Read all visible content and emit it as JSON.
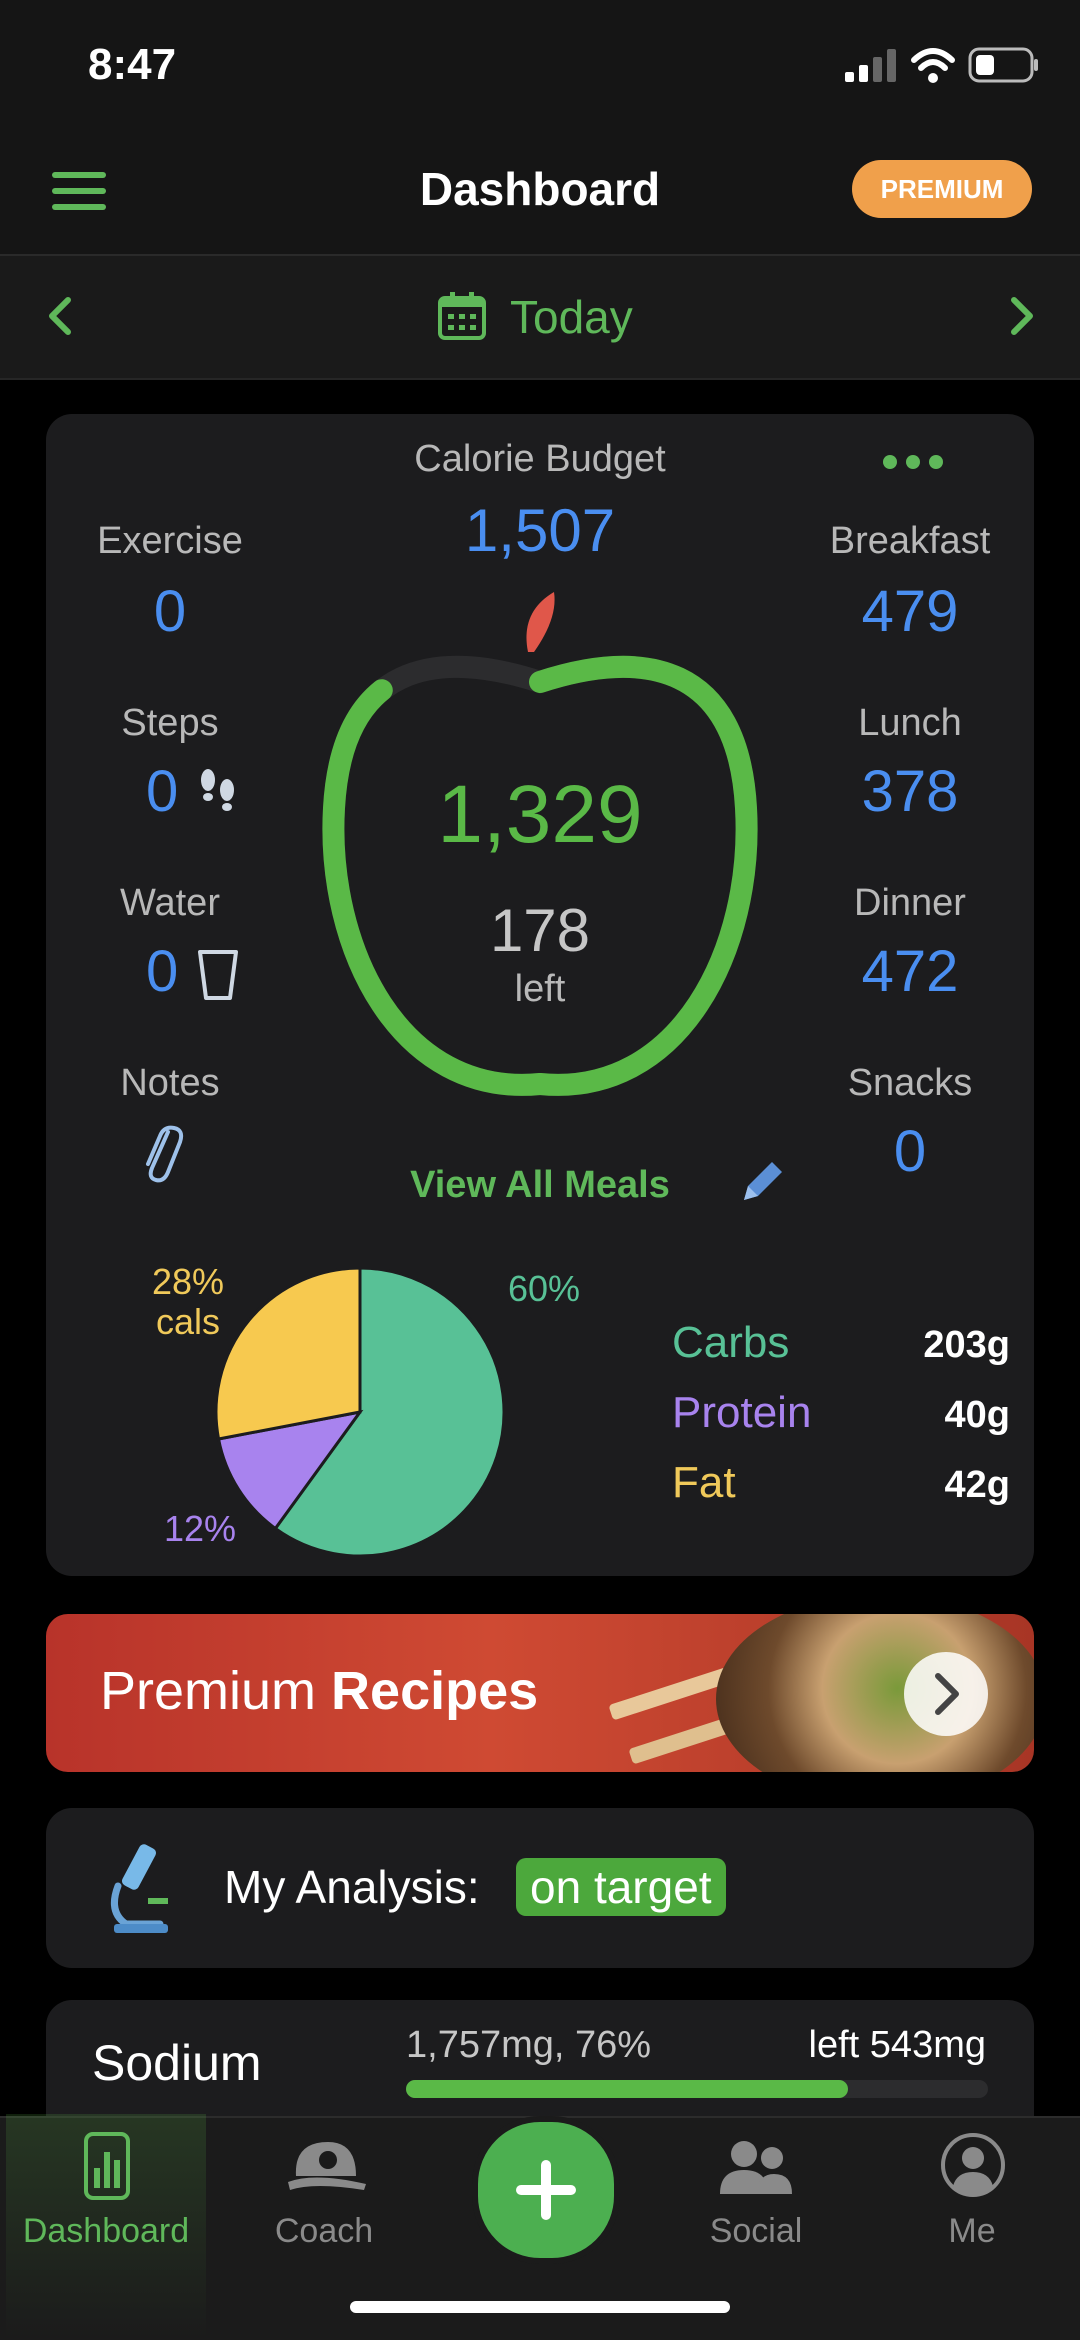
{
  "status": {
    "time": "8:47"
  },
  "header": {
    "title": "Dashboard",
    "premium_badge": "PREMIUM"
  },
  "date_nav": {
    "label": "Today"
  },
  "budget": {
    "title": "Calorie Budget",
    "value": "1,507",
    "eaten": "1,329",
    "left_value": "178",
    "left_label": "left",
    "progress_fraction": 0.88
  },
  "left_stats": [
    {
      "label": "Exercise",
      "value": "0"
    },
    {
      "label": "Steps",
      "value": "0"
    },
    {
      "label": "Water",
      "value": "0"
    },
    {
      "label": "Notes"
    }
  ],
  "meals": [
    {
      "label": "Breakfast",
      "value": "479"
    },
    {
      "label": "Lunch",
      "value": "378"
    },
    {
      "label": "Dinner",
      "value": "472"
    },
    {
      "label": "Snacks",
      "value": "0"
    }
  ],
  "view_all": "View All Meals",
  "pie": {
    "label_fat": "28%",
    "label_fat_sub": "cals",
    "label_carbs": "60%",
    "label_protein": "12%"
  },
  "chart_data": {
    "type": "pie",
    "labels": [
      "Carbs",
      "Protein",
      "Fat"
    ],
    "values": [
      60,
      12,
      28
    ],
    "colors": [
      "#58c196",
      "#a883ee",
      "#f7c94f"
    ]
  },
  "macros": [
    {
      "label": "Carbs",
      "value": "203g",
      "color": "#58c196"
    },
    {
      "label": "Protein",
      "value": "40g",
      "color": "#a883ee"
    },
    {
      "label": "Fat",
      "value": "42g",
      "color": "#f0c95a"
    }
  ],
  "recipes_banner": {
    "part1": "Premium",
    "part2": "Recipes"
  },
  "analysis": {
    "label": "My Analysis:",
    "badge": "on target"
  },
  "sodium": {
    "label": "Sodium",
    "amount": "1,757mg, 76%",
    "left": "left 543mg",
    "progress_fraction": 0.76
  },
  "tabs": [
    {
      "label": "Dashboard",
      "active": true
    },
    {
      "label": "Coach"
    },
    {
      "label": "Social"
    },
    {
      "label": "Me"
    }
  ],
  "colors": {
    "accent": "#5fb85a",
    "blue": "#4a8ef0",
    "premium": "#f0a04b"
  }
}
